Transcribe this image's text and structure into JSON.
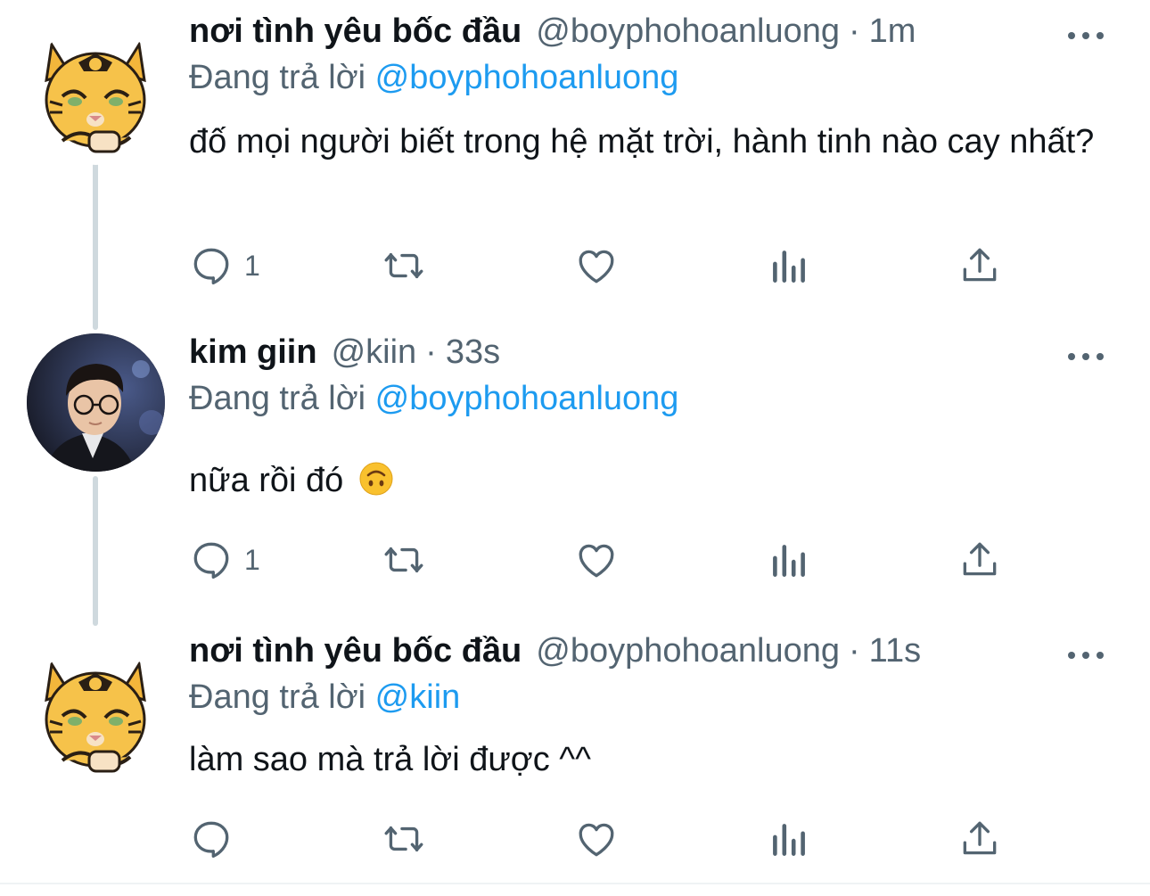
{
  "tweets": [
    {
      "name": "nơi tình yêu bốc đầu",
      "handle": "@boyphohoanluong",
      "separator": "·",
      "time": "1m",
      "reply_prefix": "Đang trả lời",
      "reply_to": "@boyphohoanluong",
      "text": "đố mọi người biết trong hệ mặt trời, hành tinh nào cay nhất?",
      "reply_count": "1",
      "avatar": "tiger-cat-avatar"
    },
    {
      "name": "kim giin",
      "handle": "@kiin",
      "separator": "·",
      "time": "33s",
      "reply_prefix": "Đang trả lời",
      "reply_to": "@boyphohoanluong",
      "text": "nữa rồi đó",
      "emoji": "upside-down-face-emoji",
      "reply_count": "1",
      "avatar": "person-photo-avatar"
    },
    {
      "name": "nơi tình yêu bốc đầu",
      "handle": "@boyphohoanluong",
      "separator": "·",
      "time": "11s",
      "reply_prefix": "Đang trả lời",
      "reply_to": "@kiin",
      "text": "làm sao mà trả lời được ^^",
      "reply_count": "",
      "avatar": "tiger-cat-avatar"
    }
  ],
  "icons": {
    "reply": "comment-icon",
    "retweet": "retweet-icon",
    "like": "heart-icon",
    "views": "analytics-icon",
    "share": "share-icon",
    "more": "more-options-icon"
  },
  "colors": {
    "text": "#0f1419",
    "secondary": "#536471",
    "accent": "#1d9bf0",
    "thread_line": "#cfd9de"
  }
}
